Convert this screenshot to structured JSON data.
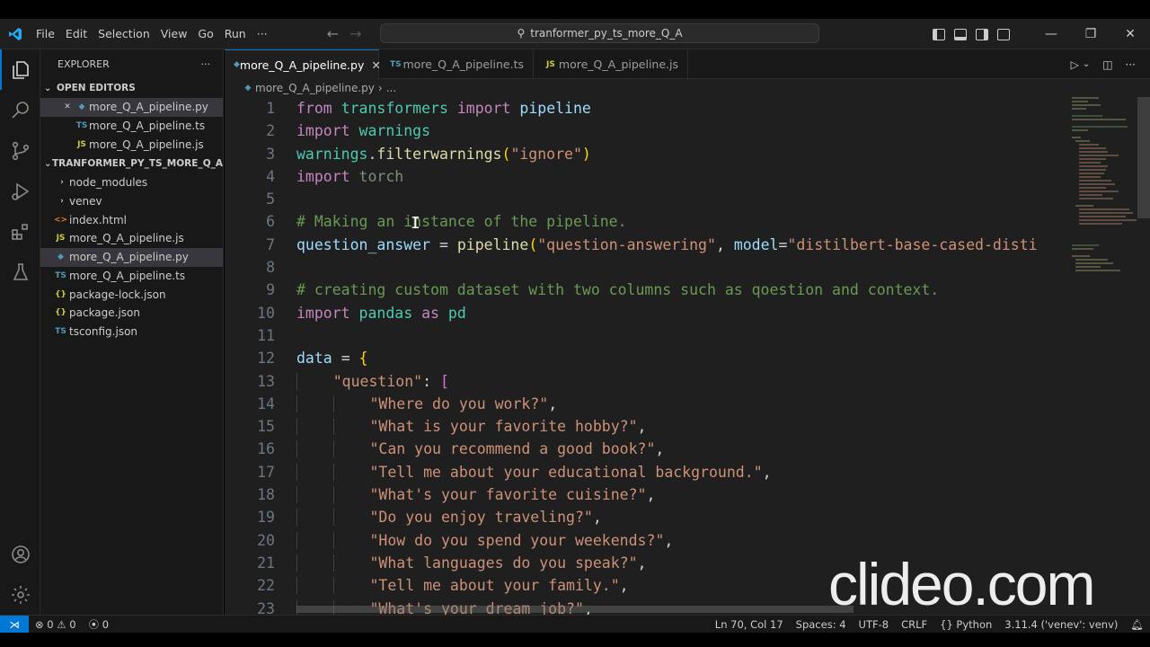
{
  "menu": [
    "File",
    "Edit",
    "Selection",
    "View",
    "Go",
    "Run",
    "···"
  ],
  "command_center": {
    "text": "tranformer_py_ts_more_Q_A"
  },
  "explorer": {
    "title": "EXPLORER",
    "more": "···",
    "open_editors": {
      "label": "OPEN EDITORS",
      "items": [
        {
          "icon": "python",
          "name": "more_Q_A_pipeline.py"
        },
        {
          "icon": "TS",
          "name": "more_Q_A_pipeline.ts"
        },
        {
          "icon": "JS",
          "name": "more_Q_A_pipeline.js"
        }
      ]
    },
    "folder": {
      "label": "TRANFORMER_PY_TS_MORE_Q_A",
      "items": [
        {
          "kind": "folder",
          "name": "node_modules"
        },
        {
          "kind": "folder",
          "name": "venev"
        },
        {
          "icon": "<>",
          "name": "index.html"
        },
        {
          "icon": "JS",
          "name": "more_Q_A_pipeline.js"
        },
        {
          "icon": "python",
          "name": "more_Q_A_pipeline.py"
        },
        {
          "icon": "TS",
          "name": "more_Q_A_pipeline.ts"
        },
        {
          "icon": "{}",
          "name": "package-lock.json"
        },
        {
          "icon": "{}",
          "name": "package.json"
        },
        {
          "icon": "TS",
          "name": "tsconfig.json"
        }
      ]
    }
  },
  "tabs": [
    {
      "icon": "python",
      "label": "more_Q_A_pipeline.py",
      "close": "✕"
    },
    {
      "icon": "TS",
      "label": "more_Q_A_pipeline.ts"
    },
    {
      "icon": "JS",
      "label": "more_Q_A_pipeline.js"
    }
  ],
  "breadcrumb": {
    "file": "more_Q_A_pipeline.py",
    "rest": "..."
  },
  "code_lines": [
    {
      "n": "1",
      "text": "from transformers import pipeline"
    },
    {
      "n": "2",
      "text": "import warnings"
    },
    {
      "n": "3",
      "text": "warnings.filterwarnings(\"ignore\")"
    },
    {
      "n": "4",
      "text": "import torch"
    },
    {
      "n": "5",
      "text": ""
    },
    {
      "n": "6",
      "text": "# Making an instance of the pipeline."
    },
    {
      "n": "7",
      "text": "question_answer = pipeline(\"question-answering\", model=\"distilbert-base-cased-disti"
    },
    {
      "n": "8",
      "text": ""
    },
    {
      "n": "9",
      "text": "# creating custom dataset with two columns such as qoestion and context."
    },
    {
      "n": "10",
      "text": "import pandas as pd"
    },
    {
      "n": "11",
      "text": ""
    },
    {
      "n": "12",
      "text": "data = {"
    },
    {
      "n": "13",
      "text": "    \"question\": ["
    },
    {
      "n": "14",
      "text": "        \"Where do you work?\","
    },
    {
      "n": "15",
      "text": "        \"What is your favorite hobby?\","
    },
    {
      "n": "16",
      "text": "        \"Can you recommend a good book?\","
    },
    {
      "n": "17",
      "text": "        \"Tell me about your educational background.\","
    },
    {
      "n": "18",
      "text": "        \"What's your favorite cuisine?\","
    },
    {
      "n": "19",
      "text": "        \"Do you enjoy traveling?\","
    },
    {
      "n": "20",
      "text": "        \"How do you spend your weekends?\","
    },
    {
      "n": "21",
      "text": "        \"What languages do you speak?\","
    },
    {
      "n": "22",
      "text": "        \"Tell me about your family.\","
    },
    {
      "n": "23",
      "text": "        \"What's your dream job?\","
    }
  ],
  "status": {
    "errors": "0",
    "warnings": "0",
    "ports": "0",
    "position": "Ln 70, Col 17",
    "spaces": "Spaces: 4",
    "encoding": "UTF-8",
    "eol": "CRLF",
    "language": "Python",
    "interpreter": "3.11.4 ('venev': venv)"
  },
  "watermark": "clideo.com",
  "colors": {
    "accent": "#0078d4",
    "keyword": "#c586c0",
    "string": "#ce9178",
    "comment": "#6a9955",
    "function": "#dcdcaa",
    "variable": "#9cdcfe"
  }
}
